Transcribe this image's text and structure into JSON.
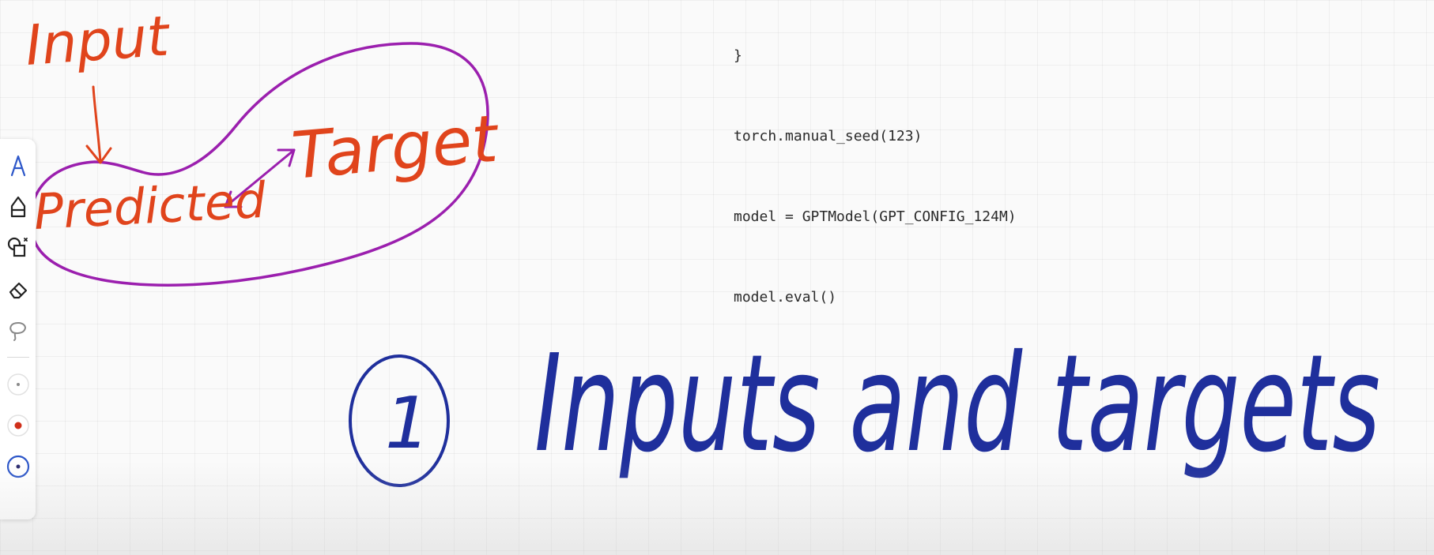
{
  "code": {
    "lines": [
      "}",
      "torch.manual_seed(123)",
      "model = GPTModel(GPT_CONFIG_124M)",
      "model.eval()"
    ]
  },
  "annotations": {
    "input_label": "Input",
    "predicted_label": "Predicted",
    "target_label": "Target",
    "heading_number": "1",
    "heading_text": "Inputs and targets"
  },
  "colors": {
    "orange_ink": "#e0441c",
    "purple_ink": "#9b1fae",
    "blue_ink": "#1f2f9c",
    "toolbar_accent": "#2d57c9",
    "swatch_gray": "#8a8a8a",
    "swatch_red": "#d0301b",
    "swatch_black": "#2b2b6e"
  },
  "toolbar": {
    "tools": [
      {
        "icon": "pen-icon"
      },
      {
        "icon": "highlighter-icon"
      },
      {
        "icon": "shapes-icon"
      },
      {
        "icon": "eraser-icon"
      },
      {
        "icon": "lasso-icon"
      }
    ],
    "swatches": [
      {
        "icon": "small-dot-icon"
      },
      {
        "icon": "red-dot-icon"
      },
      {
        "icon": "selected-dot-icon"
      }
    ]
  }
}
